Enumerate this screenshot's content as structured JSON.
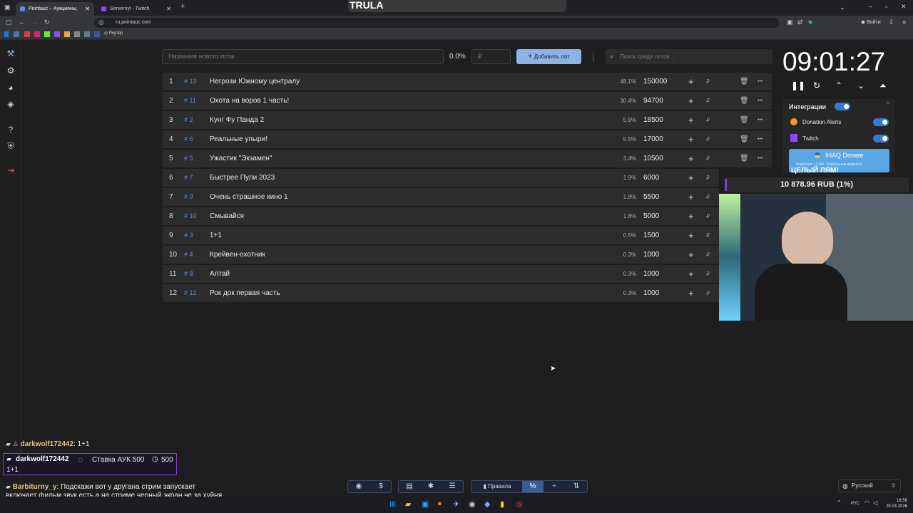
{
  "browser": {
    "tabs": [
      {
        "label": "Pointauc – Аукционы, лотереи",
        "active": true
      },
      {
        "label": "Servernyi - Twitch",
        "active": false
      }
    ],
    "overlay_title": "TRULA",
    "address": "ru.pointauc.com",
    "login_label": "Войти",
    "bookmark_label": "Роутер"
  },
  "lot_form": {
    "name_placeholder": "Название нового лота",
    "percent": "0.0%",
    "amount_placeholder": "₽",
    "add_button": "Добавить лот",
    "search_placeholder": "Поиск среди лотов..."
  },
  "lots": [
    {
      "index": "1",
      "id": "# 13",
      "name": "Негрози Южному централу",
      "percent": "48.1%",
      "amount": "150000"
    },
    {
      "index": "2",
      "id": "# 11",
      "name": "Охота на воров 1 часть!",
      "percent": "30.4%",
      "amount": "94700"
    },
    {
      "index": "3",
      "id": "# 2",
      "name": "Кунг Фу Панда 2",
      "percent": "5.9%",
      "amount": "18500"
    },
    {
      "index": "4",
      "id": "# 6",
      "name": "Реальные упыри!",
      "percent": "5.5%",
      "amount": "17000"
    },
    {
      "index": "5",
      "id": "# 5",
      "name": "Ужастик \"Экзамен\"",
      "percent": "3.4%",
      "amount": "10500"
    },
    {
      "index": "6",
      "id": "# 7",
      "name": "Быстрее Пули 2023",
      "percent": "1.9%",
      "amount": "6000"
    },
    {
      "index": "7",
      "id": "# 9",
      "name": "Очень страшное кино 1",
      "percent": "1.8%",
      "amount": "5500"
    },
    {
      "index": "8",
      "id": "# 10",
      "name": "Смывайся",
      "percent": "1.6%",
      "amount": "5000"
    },
    {
      "index": "9",
      "id": "# 3",
      "name": "1+1",
      "percent": "0.5%",
      "amount": "1500"
    },
    {
      "index": "10",
      "id": "# 4",
      "name": "Крейвен-охотник",
      "percent": "0.3%",
      "amount": "1000"
    },
    {
      "index": "11",
      "id": "# 8",
      "name": "Алтай",
      "percent": "0.3%",
      "amount": "1000"
    },
    {
      "index": "12",
      "id": "# 12",
      "name": "Рок док первая часть",
      "percent": "0.3%",
      "amount": "1000"
    }
  ],
  "currency_symbol": "₽",
  "timer": "09:01:27",
  "integrations": {
    "title": "Интеграции",
    "items": [
      "Donation Alerts",
      "Twitch"
    ],
    "donate_label": "IHAQ Donate",
    "donate_sub": "Комиссия – 3.5%. Уникальные виджеты!"
  },
  "overlay": {
    "headline": "ЦЕЛЫЙ ЛЯМ!",
    "progress_text": "10 878.96 RUB (1%)"
  },
  "chat": [
    {
      "nick": "darkwolf172442",
      "text": "1+1"
    },
    {
      "nick": "darkwolf172442",
      "bid_label": "Ставка АУК 500",
      "bid_value": "500",
      "text": "1+1"
    },
    {
      "nick": "Barbiturny_y",
      "text": "Подскажи вот у другана стрим запускает включает фильм звук есть а на стриме черный экран че за хуйня не в курсе??"
    }
  ],
  "toolbar": {
    "rules_label": "Правила"
  },
  "language": "Русский",
  "system_tray": {
    "lang": "РУС",
    "time": "18:56",
    "date": "29.03.2026"
  }
}
